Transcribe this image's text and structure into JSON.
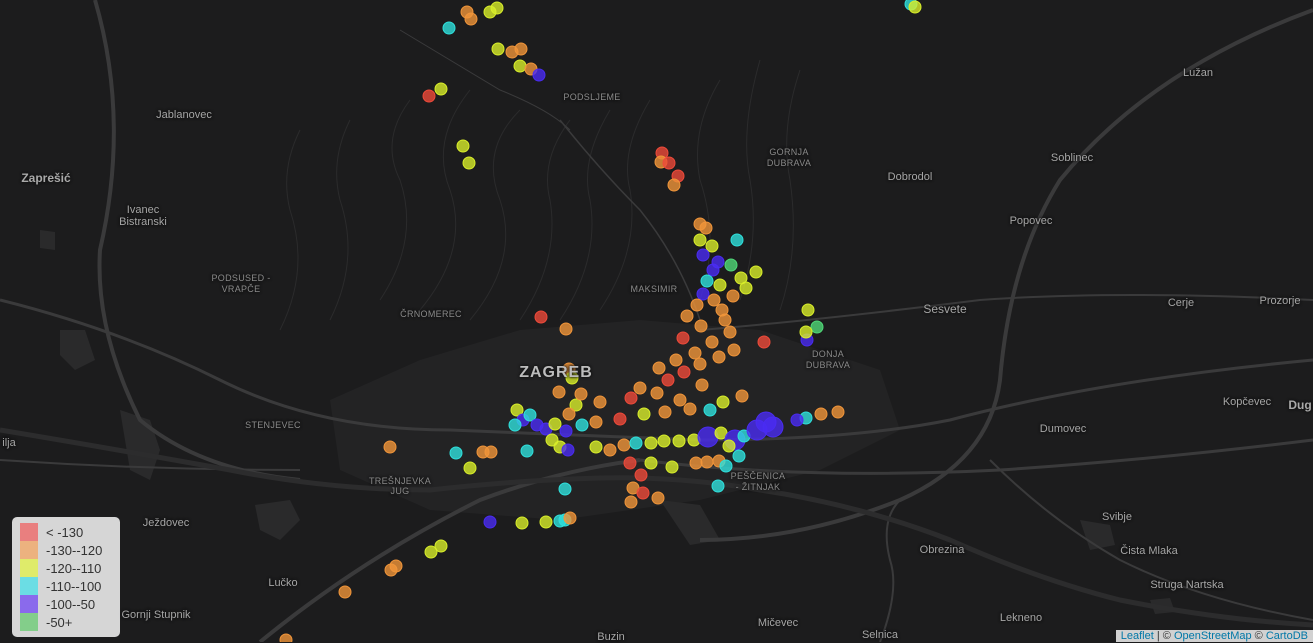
{
  "places": {
    "podsljeme": "PODSLJEME",
    "jablanovec": "Jablanovec",
    "zapresic": "Zaprešić",
    "ivanec_1": "Ivanec",
    "ivanec_2": "Bistranski",
    "gornja_dubrava_1": "GORNJA",
    "gornja_dubrava_2": "DUBRAVA",
    "dobrodol": "Dobrodol",
    "luzan": "Lužan",
    "soblinec": "Soblinec",
    "popovec": "Popovec",
    "podsused_1": "PODSUSED -",
    "podsused_2": "VRAPČE",
    "maksimir": "MAKSIMIR",
    "sesvete": "Sesvete",
    "cerje": "Cerje",
    "prozorje": "Prozorje",
    "crnomerec": "ČRNOMEREC",
    "donja_dubrava_1": "DONJA",
    "donja_dubrava_2": "DUBRAVA",
    "zagreb": "ZAGREB",
    "kopcevec": "Kopčevec",
    "dug": "Dug",
    "stenjevec": "STENJEVEC",
    "ilja": "ilja",
    "dumovec": "Dumovec",
    "pescenica_1": "PEŠČENICA",
    "pescenica_2": "- ŽITNJAK",
    "tresnjevka_1": "TREŠNJEVKA",
    "tresnjevka_2": "JUG",
    "svibje": "Svibje",
    "jezdovec": "Ježdovec",
    "obrezina": "Obrezina",
    "cista_mlaka": "Čista Mlaka",
    "lucko": "Lučko",
    "struga_nartska": "Struga Nartska",
    "gornji_stupnik": "Gornji Stupnik",
    "lekneno": "Lekneno",
    "micevec": "Mičevec",
    "buzin": "Buzin",
    "selnica": "Selnica"
  },
  "legend": {
    "items": [
      {
        "label": "< -130",
        "color": "#f15a5a"
      },
      {
        "label": "-130--120",
        "color": "#f5a35a"
      },
      {
        "label": "-120--110",
        "color": "#e2f43c"
      },
      {
        "label": "-110--100",
        "color": "#3ddfe9"
      },
      {
        "label": "-100--50",
        "color": "#6a3cf5"
      },
      {
        "label": "-50+",
        "color": "#5fca6a"
      }
    ]
  },
  "attribution": {
    "leaflet": "Leaflet",
    "sep1": " | © ",
    "osm": "OpenStreetMap",
    "sep2": " © ",
    "carto": "CartoDB"
  },
  "signal_classes": {
    "c1": "#ee4a3a",
    "c2": "#f0953a",
    "c3": "#d8ee2a",
    "c4": "#2fe0dc",
    "c5": "#4a2cf2",
    "c6": "#50d878"
  }
}
